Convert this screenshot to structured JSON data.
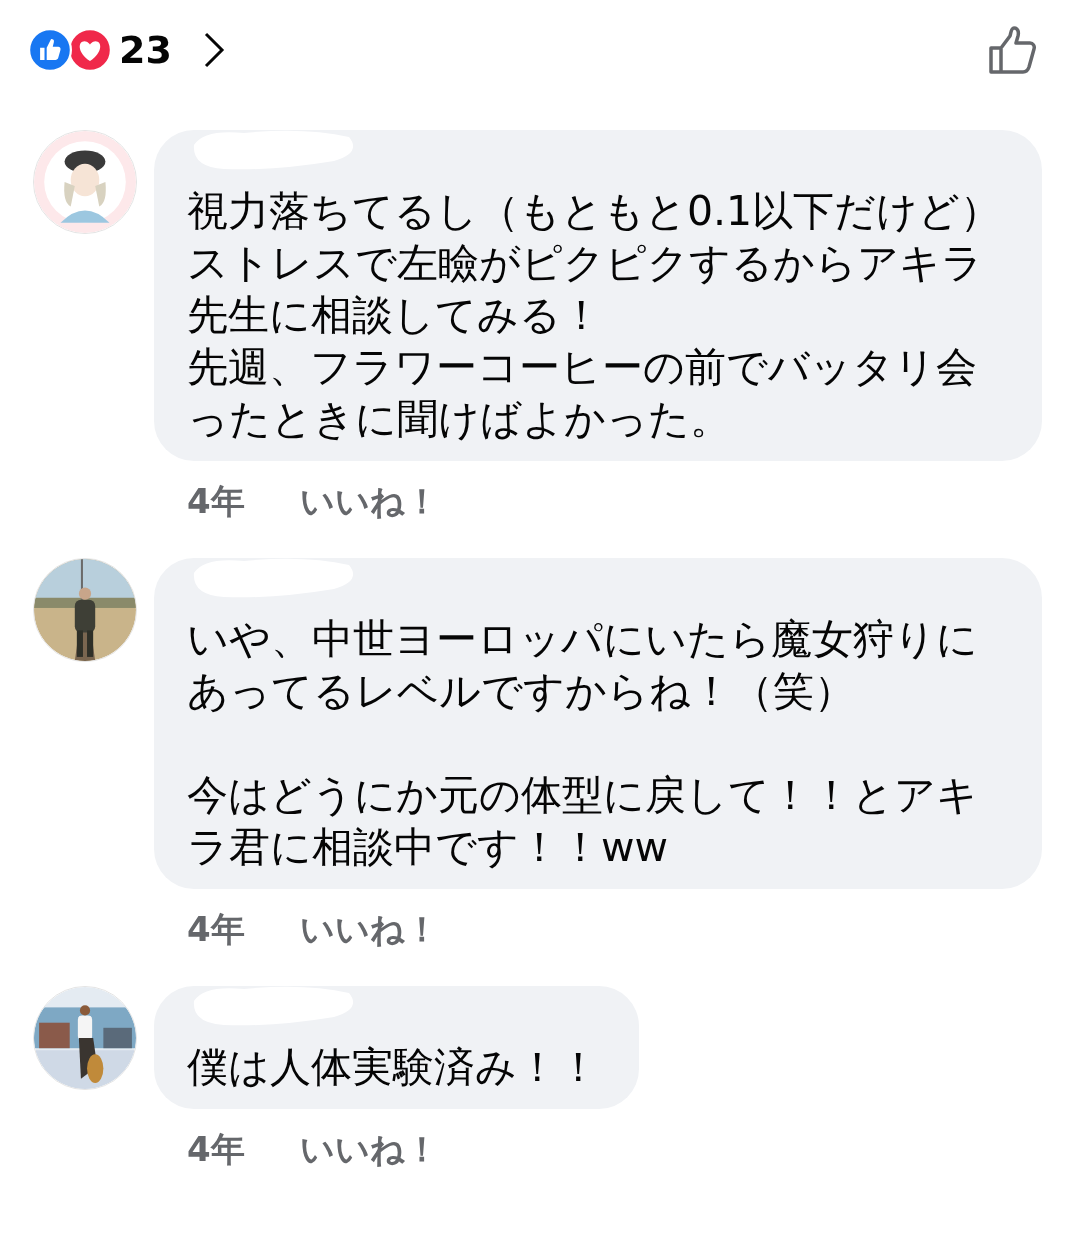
{
  "reactions": {
    "count": "23"
  },
  "comments": [
    {
      "avatar": {
        "kind": "illustration"
      },
      "paragraphs": [
        {
          "text": "視力落ちてるし（もともと0.1以下だけど）ストレスで左瞼がピクピクするからアキラ先生に相談してみる！",
          "spaced": false
        },
        {
          "text": "先週、フラワーコーヒーの前でバッタリ会ったときに聞けばよかった。",
          "spaced": false
        }
      ],
      "time": "4年",
      "like": "いいね！"
    },
    {
      "avatar": {
        "kind": "field"
      },
      "paragraphs": [
        {
          "text": "いや、中世ヨーロッパにいたら魔女狩りにあってるレベルですからね！（笑）",
          "spaced": false
        },
        {
          "text": "今はどうにか元の体型に戻して！！とアキラ君に相談中です！！ww",
          "spaced": true
        }
      ],
      "time": "4年",
      "like": "いいね！"
    },
    {
      "avatar": {
        "kind": "street"
      },
      "paragraphs": [
        {
          "text": "僕は人体実験済み！！",
          "spaced": false
        }
      ],
      "time": "4年",
      "like": "いいね！"
    }
  ]
}
